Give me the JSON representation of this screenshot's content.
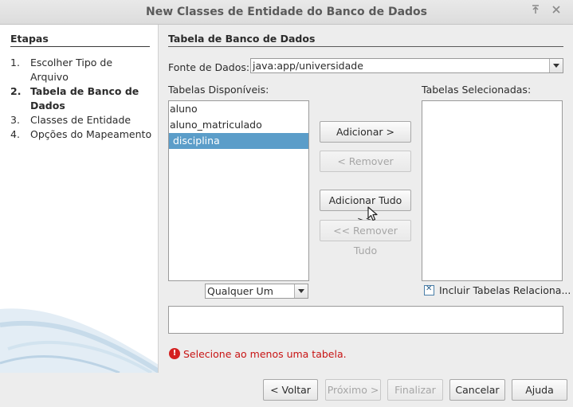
{
  "window": {
    "title": "New Classes de Entidade do Banco de Dados",
    "icons": [
      "pin-icon",
      "close-icon"
    ]
  },
  "sidebar": {
    "heading": "Etapas",
    "steps": [
      {
        "num": "1.",
        "label": "Escolher Tipo de Arquivo",
        "current": false
      },
      {
        "num": "2.",
        "label": "Tabela de Banco de Dados",
        "current": true
      },
      {
        "num": "3.",
        "label": "Classes de Entidade",
        "current": false
      },
      {
        "num": "4.",
        "label": "Opções do Mapeamento",
        "current": false
      }
    ]
  },
  "main": {
    "section_title": "Tabela de Banco de Dados",
    "datasource": {
      "label": "Fonte de Dados:",
      "value": "java:app/universidade"
    },
    "available": {
      "label": "Tabelas Disponíveis:",
      "items": [
        "aluno",
        "aluno_matriculado",
        "disciplina"
      ],
      "selected_index": 2,
      "filter": "Qualquer Um"
    },
    "selected": {
      "label": "Tabelas Selecionadas:",
      "items": []
    },
    "buttons": {
      "add": "Adicionar >",
      "remove": "< Remover",
      "add_all": "Adicionar Tudo >>",
      "remove_all": "<< Remover Tudo"
    },
    "include_related": {
      "label": "Incluir Tabelas Relaciona...",
      "checked": true
    },
    "error": "Selecione ao menos uma tabela."
  },
  "footer": {
    "back": "< Voltar",
    "next": "Próximo >",
    "finish": "Finalizar",
    "cancel": "Cancelar",
    "help": "Ajuda"
  },
  "colors": {
    "selection": "#5b9dc9",
    "error": "#c81414",
    "window_bg": "#ededed"
  }
}
